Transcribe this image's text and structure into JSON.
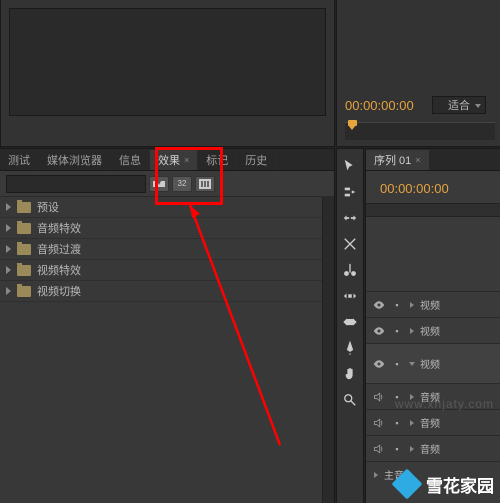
{
  "top": {
    "timecode": "00:00:00:00",
    "zoom_label": "适合"
  },
  "panel": {
    "tabs": [
      {
        "label": "测试"
      },
      {
        "label": "媒体浏览器"
      },
      {
        "label": "信息"
      },
      {
        "label": "效果"
      },
      {
        "label": "标记"
      },
      {
        "label": "历史"
      }
    ],
    "active_tab": "效果",
    "search_placeholder": "",
    "filter_32": "32",
    "tree": [
      {
        "label": "预设"
      },
      {
        "label": "音频特效"
      },
      {
        "label": "音频过渡"
      },
      {
        "label": "视频特效"
      },
      {
        "label": "视频切换"
      }
    ]
  },
  "sequence": {
    "tab_label": "序列 01",
    "timecode": "00:00:00:00",
    "tracks": [
      {
        "kind": "video",
        "label": "视频"
      },
      {
        "kind": "video",
        "label": "视频"
      },
      {
        "kind": "video_expanded",
        "label": "视频"
      },
      {
        "kind": "audio",
        "label": "音频"
      },
      {
        "kind": "audio",
        "label": "音频"
      },
      {
        "kind": "audio",
        "label": "音频"
      },
      {
        "kind": "master",
        "label": "主音"
      }
    ]
  },
  "watermark": {
    "url": "www.xhjaty.com",
    "brand": "雪花家园"
  },
  "icons": {
    "selection": "selection-tool",
    "track_select": "track-select-tool",
    "ripple": "ripple-edit-tool",
    "rolling": "rolling-edit-tool",
    "rate": "rate-stretch-tool",
    "razor": "razor-tool",
    "slip": "slip-tool",
    "slide": "slide-tool",
    "pen": "pen-tool",
    "hand": "hand-tool",
    "zoom": "zoom-tool"
  }
}
